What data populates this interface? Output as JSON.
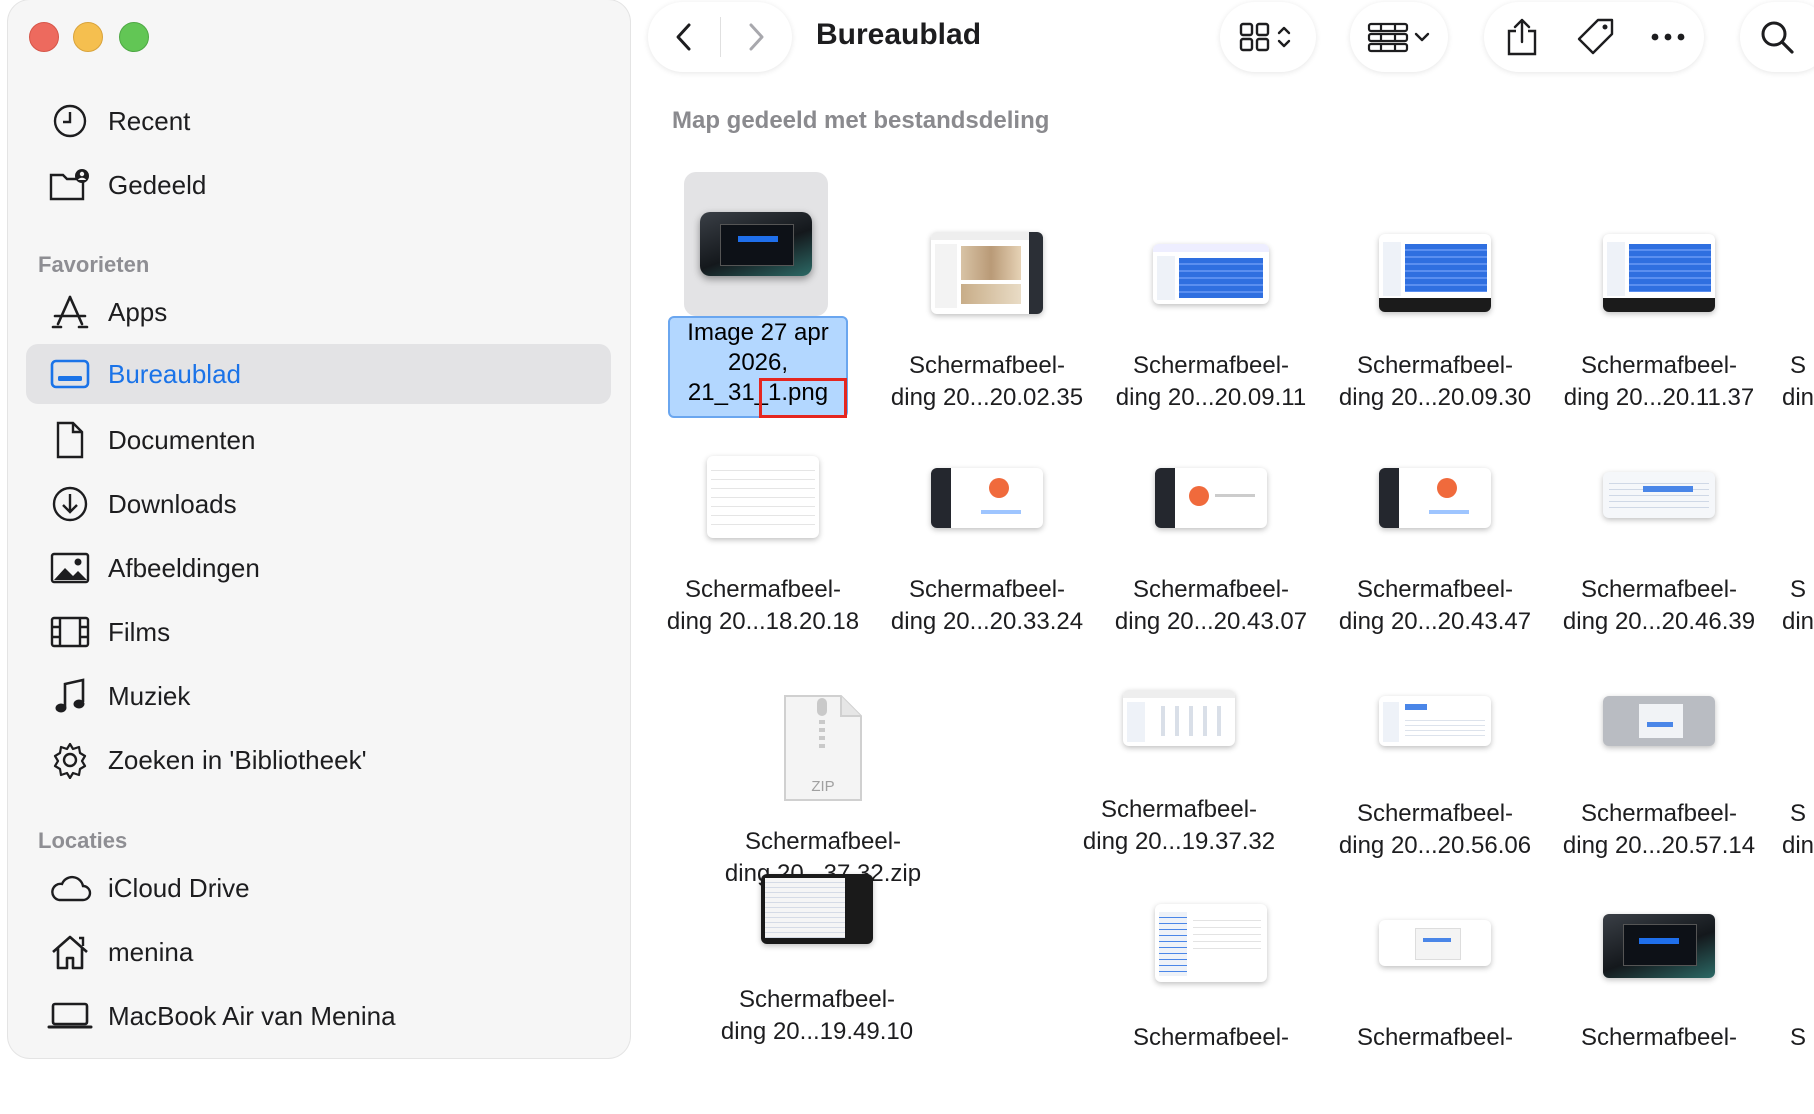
{
  "window": {
    "title": "Bureaublad"
  },
  "sidebar": {
    "items_top": [
      {
        "label": "Recent",
        "icon": "clock-icon"
      },
      {
        "label": "Gedeeld",
        "icon": "shared-folder-icon"
      }
    ],
    "favorites_heading": "Favorieten",
    "favorites": [
      {
        "label": "Apps",
        "icon": "apps-icon"
      },
      {
        "label": "Bureaublad",
        "icon": "desktop-icon",
        "active": true
      },
      {
        "label": "Documenten",
        "icon": "document-icon"
      },
      {
        "label": "Downloads",
        "icon": "download-icon"
      },
      {
        "label": "Afbeeldingen",
        "icon": "photo-icon"
      },
      {
        "label": "Films",
        "icon": "film-icon"
      },
      {
        "label": "Muziek",
        "icon": "music-icon"
      },
      {
        "label": "Zoeken in 'Bibliotheek'",
        "icon": "gear-icon"
      }
    ],
    "locations_heading": "Locaties",
    "locations": [
      {
        "label": "iCloud Drive",
        "icon": "cloud-icon"
      },
      {
        "label": "menina",
        "icon": "home-icon"
      },
      {
        "label": "MacBook Air van Menina",
        "icon": "laptop-icon"
      }
    ]
  },
  "main": {
    "section_title": "Map gedeeld met bestandsdeling",
    "selected_file": {
      "line1": "Image 27 apr",
      "line2": "2026,",
      "line3_a": "21_31_",
      "line3_b": "1.png"
    },
    "files": [
      {
        "l1": "Schermafbeel-",
        "l2": "ding 20...20.02.35"
      },
      {
        "l1": "Schermafbeel-",
        "l2": "ding 20...20.09.11"
      },
      {
        "l1": "Schermafbeel-",
        "l2": "ding 20...20.09.30"
      },
      {
        "l1": "Schermafbeel-",
        "l2": "ding 20...20.11.37"
      },
      {
        "l1": "Schermafbeel-",
        "l2": "ding 20...18.20.18"
      },
      {
        "l1": "Schermafbeel-",
        "l2": "ding 20...20.33.24"
      },
      {
        "l1": "Schermafbeel-",
        "l2": "ding 20...20.43.07"
      },
      {
        "l1": "Schermafbeel-",
        "l2": "ding 20...20.43.47"
      },
      {
        "l1": "Schermafbeel-",
        "l2": "ding 20...20.46.39"
      },
      {
        "l1": "Schermafbeel-",
        "l2": "ding 20...37.32.zip"
      },
      {
        "l1": "Schermafbeel-",
        "l2": "ding 20...19.37.32"
      },
      {
        "l1": "Schermafbeel-",
        "l2": "ding 20...20.56.06"
      },
      {
        "l1": "Schermafbeel-",
        "l2": "ding 20...20.57.14"
      },
      {
        "l1": "Schermafbeel-",
        "l2": "ding 20...19.49.10"
      },
      {
        "l1": "Schermafbeel-",
        "l2": ""
      },
      {
        "l1": "Schermafbeel-",
        "l2": ""
      },
      {
        "l1": "Schermafbeel-",
        "l2": ""
      }
    ],
    "cut_off": {
      "l1": "S",
      "l2": "din"
    },
    "zip_label": "ZIP"
  }
}
